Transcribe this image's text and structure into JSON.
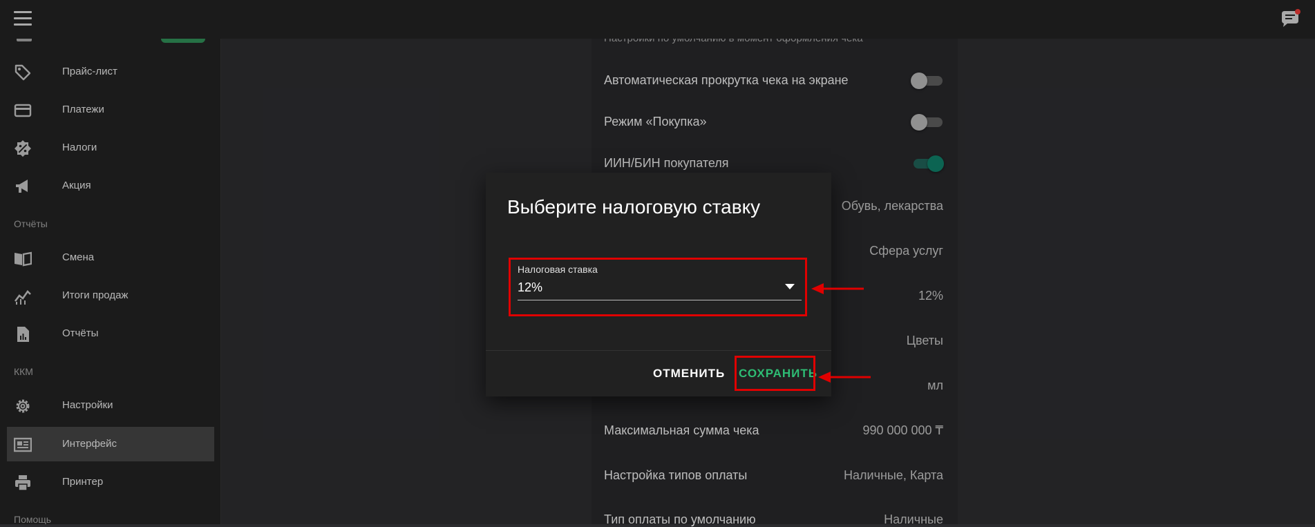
{
  "topbar": {
    "menu_icon": "hamburger-menu-icon",
    "chat_icon": "chat-notification-icon"
  },
  "sidebar": {
    "items": [
      {
        "label": "Прайс-лист",
        "icon": "price-tag-icon"
      },
      {
        "label": "Платежи",
        "icon": "credit-card-icon"
      },
      {
        "label": "Налоги",
        "icon": "tax-percent-icon"
      },
      {
        "label": "Акция",
        "icon": "megaphone-icon"
      }
    ],
    "section_reports": "Отчёты",
    "reports_items": [
      {
        "label": "Смена",
        "icon": "book-icon"
      },
      {
        "label": "Итоги продаж",
        "icon": "chart-icon"
      },
      {
        "label": "Отчёты",
        "icon": "report-file-icon"
      }
    ],
    "section_kkm": "ККМ",
    "kkm_items": [
      {
        "label": "Настройки",
        "icon": "gear-icon"
      },
      {
        "label": "Интерфейс",
        "icon": "interface-icon",
        "active": true
      },
      {
        "label": "Принтер",
        "icon": "printer-icon"
      }
    ],
    "section_help": "Помощь"
  },
  "settings": {
    "hint": "Настройки по умолчанию в момент оформления чека",
    "rows": [
      {
        "label": "Автоматическая прокрутка чека на экране",
        "toggle": false
      },
      {
        "label": "Режим «Покупка»",
        "toggle": false
      },
      {
        "label": "ИИН/БИН покупателя",
        "toggle": true
      }
    ],
    "values": {
      "v1": "Обувь, лекарства",
      "v2": "Сфера услуг",
      "v3": "12%",
      "v4": "Цветы",
      "v5": "мл"
    },
    "max_sum_label": "Максимальная сумма чека",
    "max_sum_value": "990 000 000 ₸",
    "payment_types_label": "Настройка типов оплаты",
    "payment_types_value": "Наличные, Карта",
    "default_payment_label": "Тип оплаты по умолчанию",
    "default_payment_value": "Наличные"
  },
  "dialog": {
    "title": "Выберите налоговую ставку",
    "field_label": "Налоговая ставка",
    "field_value": "12%",
    "cancel": "ОТМЕНИТЬ",
    "save": "СОХРАНИТЬ"
  },
  "colors": {
    "accent_green": "#2ebd74",
    "highlight_red": "#e00000",
    "toggle_on": "#0f7a64"
  }
}
